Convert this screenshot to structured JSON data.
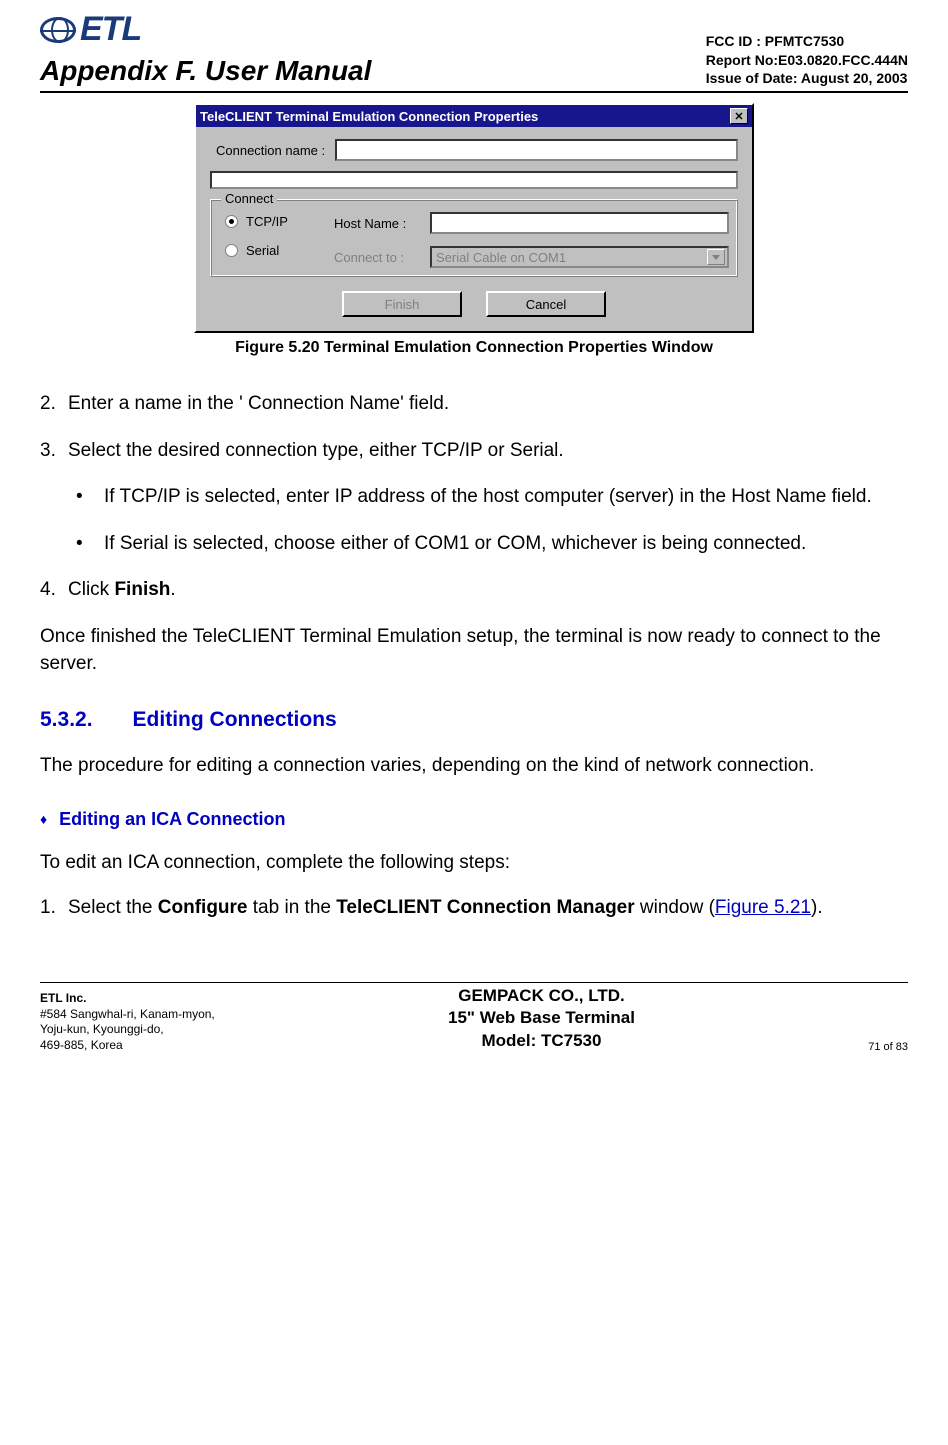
{
  "header": {
    "logo_text": "ETL",
    "appendix_title": "Appendix F. User Manual",
    "fcc_id": "FCC ID : PFMTC7530",
    "report_no": "Report No:E03.0820.FCC.444N",
    "issue_date": "Issue of Date:  August 20, 2003"
  },
  "dialog": {
    "title": "TeleCLIENT Terminal Emulation Connection Properties",
    "conn_name_label": "Connection name :",
    "conn_name_value": "",
    "connect_legend": "Connect",
    "radio_tcpip": "TCP/IP",
    "radio_serial": "Serial",
    "host_name_label": "Host Name :",
    "host_name_value": "",
    "connect_to_label": "Connect to :",
    "connect_to_value": "Serial Cable on COM1",
    "finish_btn": "Finish",
    "cancel_btn": "Cancel"
  },
  "figure_caption": "Figure 5.20   Terminal Emulation Connection Properties Window",
  "steps": {
    "s2_num": "2.",
    "s2_text": "Enter a name in the ' Connection Name'  field.",
    "s3_num": "3.",
    "s3_text": "Select the desired connection type, either TCP/IP or Serial.",
    "b1": "If TCP/IP is selected, enter IP address of the host computer (server) in the Host Name field.",
    "b2": "If Serial is selected, choose either of COM1 or COM, whichever is being connected.",
    "s4_num": "4.",
    "s4_pre": "Click ",
    "s4_bold": "Finish",
    "s4_post": "."
  },
  "para_finished": "Once finished the TeleCLIENT Terminal Emulation setup, the terminal is now ready to connect to the server.",
  "section": {
    "num": "5.3.2.",
    "title": "Editing Connections",
    "intro": "The procedure for editing a connection varies, depending on the kind of network connection."
  },
  "subsection": {
    "title": "Editing an ICA Connection",
    "intro": "To edit an ICA connection, complete the following steps:",
    "s1_num": "1.",
    "s1_pre": "Select the ",
    "s1_b1": "Configure",
    "s1_mid": " tab in the ",
    "s1_b2": "TeleCLIENT Connection Manager",
    "s1_post1": " window (",
    "s1_link": "Figure 5.21",
    "s1_post2": ")."
  },
  "footer": {
    "company": "ETL Inc.",
    "addr1": "#584 Sangwhal-ri, Kanam-myon,",
    "addr2": "Yoju-kun, Kyounggi-do,",
    "addr3": "469-885, Korea",
    "center1": "GEMPACK CO., LTD.",
    "center2": "15\" Web Base Terminal",
    "center3": "Model: TC7530",
    "page": "71 of  83"
  }
}
